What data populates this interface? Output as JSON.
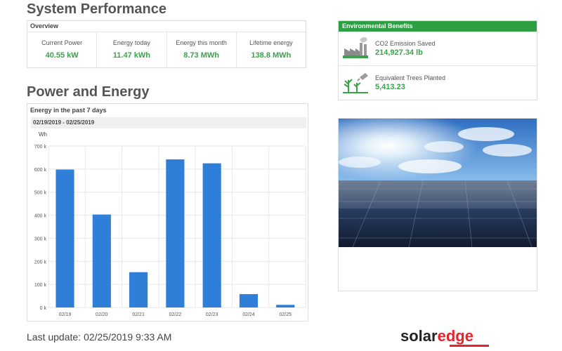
{
  "page": {
    "title": "System Performance",
    "section_title": "Power and Energy",
    "last_update_label": "Last update:",
    "last_update_value": "02/25/2019 9:33 AM"
  },
  "overview": {
    "heading": "Overview",
    "items": [
      {
        "label": "Current Power",
        "value": "40.55 kW"
      },
      {
        "label": "Energy today",
        "value": "11.47 kWh"
      },
      {
        "label": "Energy this month",
        "value": "8.73 MWh"
      },
      {
        "label": "Lifetime energy",
        "value": "138.8 MWh"
      }
    ]
  },
  "environmental": {
    "heading": "Environmental Benefits",
    "items": [
      {
        "label": "CO2 Emission Saved",
        "value": "214,927.34 lb",
        "icon": "factory-icon"
      },
      {
        "label": "Equivalent Trees Planted",
        "value": "5,413.23",
        "icon": "trees-icon"
      }
    ]
  },
  "chart_panel": {
    "title": "Energy in the past 7 days",
    "date_range": "02/19/2019 - 02/25/2019"
  },
  "chart_data": {
    "type": "bar",
    "ylabel": "Wh",
    "categories": [
      "02/19",
      "02/20",
      "02/21",
      "02/22",
      "02/23",
      "02/24",
      "02/25"
    ],
    "values": [
      598000,
      403000,
      153000,
      642000,
      625000,
      58000,
      11470
    ],
    "ylim": [
      0,
      700000
    ],
    "yticks": [
      0,
      100000,
      200000,
      300000,
      400000,
      500000,
      600000,
      700000
    ],
    "ytick_labels": [
      "0 k",
      "100 k",
      "200 k",
      "300 k",
      "400 k",
      "500 k",
      "600 k",
      "700 k"
    ],
    "grid": true,
    "bar_color": "#2f7fd8"
  },
  "brand": {
    "logo_part1": "solar",
    "logo_part2": "edge",
    "accent_color": "#e8212b"
  },
  "colors": {
    "value_green": "#3aa34a",
    "header_green": "#2ea043"
  }
}
